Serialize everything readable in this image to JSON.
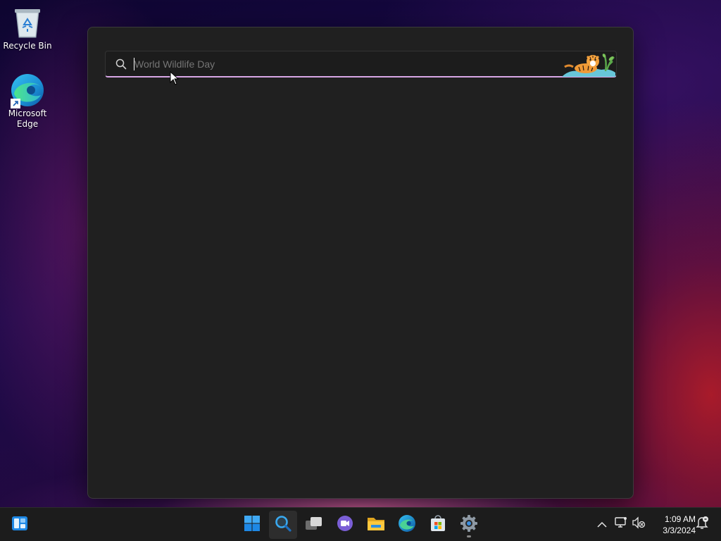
{
  "desktop": {
    "icons": [
      {
        "label": "Recycle Bin",
        "icon": "recycle-bin-icon"
      },
      {
        "label": "Microsoft Edge",
        "icon": "edge-icon"
      }
    ]
  },
  "search": {
    "placeholder": "World Wildlife Day",
    "value": "",
    "icon": "search-icon",
    "doodle": "tiger-doodle-icon",
    "accent": "#d7a6e6"
  },
  "taskbar": {
    "items": [
      {
        "name": "widgets",
        "icon": "widgets-icon"
      },
      {
        "name": "start",
        "icon": "windows-start-icon"
      },
      {
        "name": "search",
        "icon": "search-icon"
      },
      {
        "name": "task-view",
        "icon": "task-view-icon"
      },
      {
        "name": "chat",
        "icon": "teams-chat-icon"
      },
      {
        "name": "file-explorer",
        "icon": "folder-icon"
      },
      {
        "name": "edge",
        "icon": "edge-icon"
      },
      {
        "name": "store",
        "icon": "store-icon"
      },
      {
        "name": "settings",
        "icon": "gear-icon"
      }
    ],
    "tray": {
      "time": "1:09 AM",
      "date": "3/3/2024"
    }
  }
}
